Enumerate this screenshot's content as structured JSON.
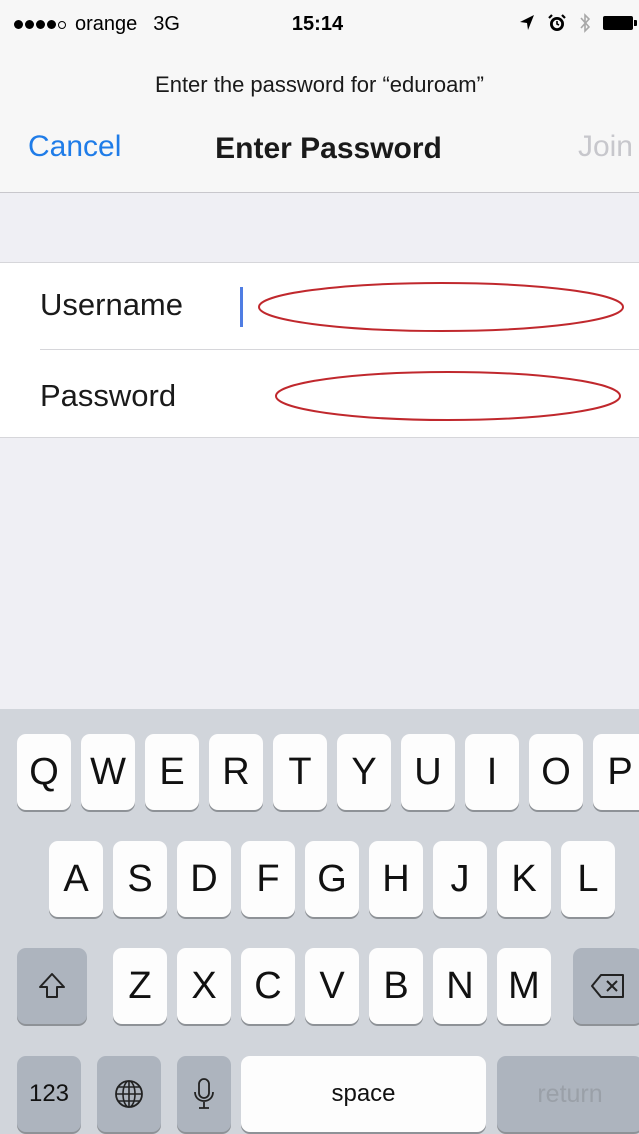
{
  "status_bar": {
    "carrier": "orange",
    "network": "3G",
    "time": "15:14"
  },
  "header": {
    "prompt": "Enter the password for “eduroam”",
    "cancel_label": "Cancel",
    "title": "Enter Password",
    "join_label": "Join"
  },
  "form": {
    "username_label": "Username",
    "username_value": "",
    "password_label": "Password",
    "password_value": ""
  },
  "keyboard": {
    "row1": [
      "Q",
      "W",
      "E",
      "R",
      "T",
      "Y",
      "U",
      "I",
      "O",
      "P"
    ],
    "row2": [
      "A",
      "S",
      "D",
      "F",
      "G",
      "H",
      "J",
      "K",
      "L"
    ],
    "row3": [
      "Z",
      "X",
      "C",
      "V",
      "B",
      "N",
      "M"
    ],
    "numbers_label": "123",
    "space_label": "space",
    "return_label": "return"
  },
  "colors": {
    "accent": "#1f7ce8",
    "disabled": "#c7c7cc",
    "redaction": "#c0282d",
    "cursor": "#4f7de3"
  },
  "icons": {
    "location": "location-arrow-icon",
    "alarm": "alarm-clock-icon",
    "bluetooth": "bluetooth-icon",
    "battery": "battery-icon",
    "shift": "shift-icon",
    "delete": "delete-icon",
    "globe": "globe-icon",
    "microphone": "microphone-icon"
  }
}
